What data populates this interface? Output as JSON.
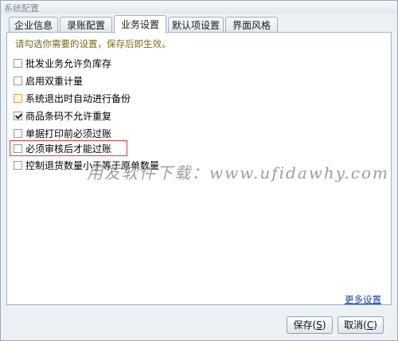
{
  "window": {
    "title": "系统配置"
  },
  "tabs": [
    {
      "label": "企业信息"
    },
    {
      "label": "录账配置"
    },
    {
      "label": "业务设置"
    },
    {
      "label": "默认项设置"
    },
    {
      "label": "界面风格"
    }
  ],
  "panel": {
    "hint": "请勾选你需要的设置，保存后即生效。",
    "options": [
      {
        "label": "批发业务允许负库存",
        "checked": false
      },
      {
        "label": "启用双重计量",
        "checked": false
      },
      {
        "label": "系统退出时自动进行备份",
        "checked": false
      },
      {
        "label": "商品条码不允许重复",
        "checked": true
      },
      {
        "label": "单据打印前必须过账",
        "checked": false
      },
      {
        "label": "必须审核后才能过账",
        "checked": false
      },
      {
        "label": "控制退货数量小于等于原单数量",
        "checked": false
      }
    ],
    "more_link": "更多设置"
  },
  "watermark": "用友软件下载：www.ufidawhy.com",
  "buttons": {
    "save": "保存",
    "save_key": "S",
    "cancel": "取消",
    "cancel_key": "C"
  },
  "colors": {
    "hint_text": "#7a6a1c",
    "highlight_border": "#e03a3a",
    "link": "#1a3ea8"
  }
}
